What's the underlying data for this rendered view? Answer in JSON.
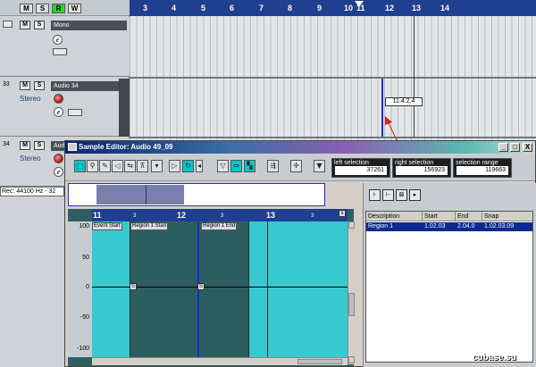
{
  "project": {
    "global_buttons": [
      "M",
      "S",
      "R",
      "W"
    ],
    "tracks": [
      {
        "number": "",
        "name": "Mono",
        "type_label": ""
      },
      {
        "number": "33",
        "name": "Audio 34",
        "type_label": "Stereo"
      },
      {
        "number": "34",
        "name": "Audi",
        "type_label": "Stereo"
      }
    ],
    "track_buttons": [
      "M",
      "S"
    ],
    "edit_button": "e",
    "ruler": [
      "3",
      "4",
      "5",
      "6",
      "7",
      "8",
      "9",
      "10",
      "11",
      "12",
      "13",
      "14"
    ],
    "position_tooltip": "11.4.2.4",
    "status": "Rec: 44100 Hz - 32"
  },
  "editor": {
    "title": "Sample Editor: Audio 49_09",
    "window_buttons": [
      "_",
      "□",
      "X"
    ],
    "selection": {
      "left_label": "left selection",
      "left_value": "37261",
      "right_label": "right selection",
      "right_value": "156923",
      "range_label": "selection range",
      "range_value": "119663"
    },
    "ruler": {
      "labels": [
        "11",
        "12",
        "13"
      ],
      "sub": [
        "3",
        "3",
        "3"
      ],
      "marker": "s"
    },
    "y_axis": [
      "100",
      "50",
      "0",
      "-50",
      "-100"
    ],
    "flags": [
      "Event Start",
      "Region 1 Start",
      "Region 1 End"
    ],
    "snap_marker": "S",
    "region_table": {
      "columns": [
        "Description",
        "Start",
        "End",
        "Snap"
      ],
      "rows": [
        {
          "description": "Region 1",
          "start": "1.02.03",
          "end": "2.04.0",
          "snap": "1.02.03.09"
        }
      ]
    }
  },
  "watermark": "cubase.su"
}
